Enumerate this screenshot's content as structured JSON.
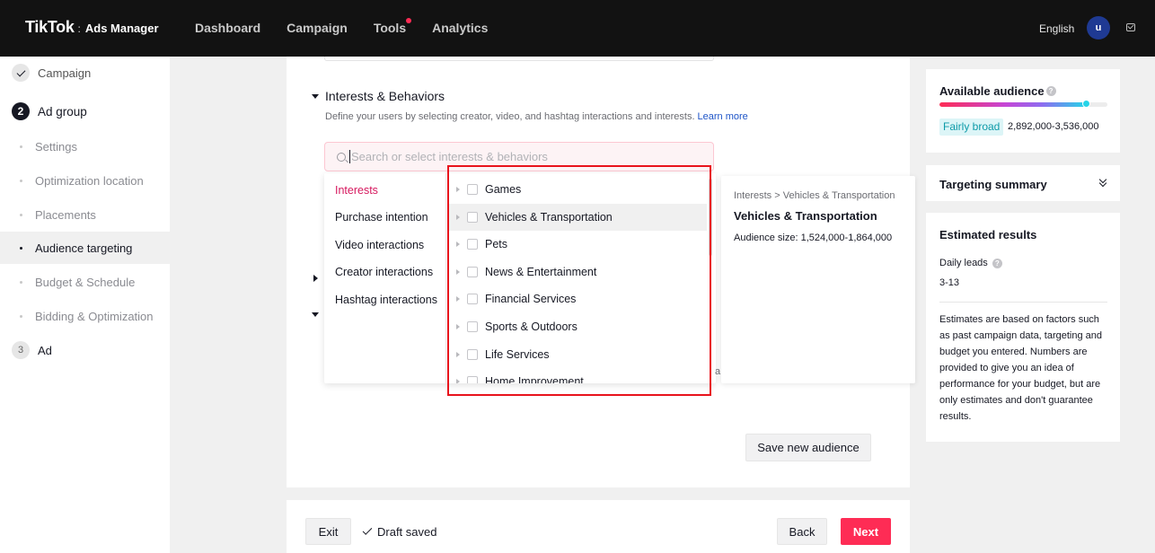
{
  "header": {
    "brand_main": "TikTok",
    "brand_separator": ":",
    "brand_sub": "Ads Manager",
    "nav": [
      {
        "label": "Dashboard",
        "dot": false
      },
      {
        "label": "Campaign",
        "dot": false
      },
      {
        "label": "Tools",
        "dot": true
      },
      {
        "label": "Analytics",
        "dot": false
      }
    ],
    "language": "English",
    "avatar_initial": "u",
    "icons": {
      "notification": "mail-icon"
    },
    "dot_color": "#fe2c55"
  },
  "sidebar": {
    "steps": [
      {
        "label": "Campaign",
        "state": "done",
        "marker": ""
      },
      {
        "label": "Ad group",
        "state": "active",
        "marker": "2"
      },
      {
        "label": "Ad",
        "state": "pending",
        "marker": "3"
      }
    ],
    "subitems": [
      {
        "label": "Settings",
        "active": false
      },
      {
        "label": "Optimization location",
        "active": false
      },
      {
        "label": "Placements",
        "active": false
      },
      {
        "label": "Audience targeting",
        "active": true
      },
      {
        "label": "Budget & Schedule",
        "active": false
      },
      {
        "label": "Bidding & Optimization",
        "active": false
      }
    ]
  },
  "main": {
    "section_title": "Interests & Behaviors",
    "section_desc": "Define your users by selecting creator, video, and hashtag interactions and interests.",
    "learn_more": "Learn more",
    "search_placeholder": "Search or select interests & behaviors",
    "search_value": "",
    "categories": [
      {
        "label": "Interests",
        "active": true
      },
      {
        "label": "Purchase intention",
        "active": false
      },
      {
        "label": "Video interactions",
        "active": false
      },
      {
        "label": "Creator interactions",
        "active": false
      },
      {
        "label": "Hashtag interactions",
        "active": false
      }
    ],
    "options": [
      {
        "label": "Games",
        "checked": false,
        "hover": false
      },
      {
        "label": "Vehicles & Transportation",
        "checked": false,
        "hover": true
      },
      {
        "label": "Pets",
        "checked": false,
        "hover": false
      },
      {
        "label": "News & Entertainment",
        "checked": false,
        "hover": false
      },
      {
        "label": "Financial Services",
        "checked": false,
        "hover": false
      },
      {
        "label": "Sports & Outdoors",
        "checked": false,
        "hover": false
      },
      {
        "label": "Life Services",
        "checked": false,
        "hover": false
      },
      {
        "label": "Home Improvement",
        "checked": false,
        "hover": false
      }
    ],
    "behind_text": "a",
    "detail": {
      "path": "Interests > Vehicles & Transportation",
      "title": "Vehicles & Transportation",
      "audience_size": "Audience size: 1,524,000-1,864,000"
    },
    "save_audience_label": "Save new audience",
    "highlight_color": "#e8131c",
    "accent_color": "#d6185e"
  },
  "footer": {
    "exit_label": "Exit",
    "draft_label": "Draft saved",
    "back_label": "Back",
    "next_label": "Next",
    "next_color": "#fe2c55"
  },
  "right": {
    "available": {
      "title": "Available audience",
      "help_glyph": "?",
      "breadth_fraction": 0.87,
      "badge": "Fairly broad",
      "range": "2,892,000-3,536,000"
    },
    "targeting_summary": {
      "title": "Targeting summary",
      "toggle_icon": "double-chevron-down-icon"
    },
    "estimated": {
      "title": "Estimated results",
      "leads_label": "Daily leads",
      "help_glyph": "?",
      "leads_value": "3-13",
      "note": "Estimates are based on factors such as past campaign data, targeting and budget you entered. Numbers are provided to give you an idea of performance for your budget, but are only estimates and don't guarantee results."
    }
  }
}
